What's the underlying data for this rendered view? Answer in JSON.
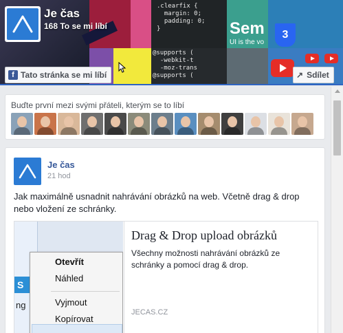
{
  "cover": {
    "page_name": "Je čas",
    "likes_text": "168 To se mi líbí",
    "code_top": ".clearfix {\n  margin: 0;\n  padding: 0;\n}",
    "code_bottom": "@supports (\n  -webkit-t\n  -moz-trans\n@supports (",
    "sem_text": "Sem",
    "sem_sub": "UI is the vo",
    "css3_label": "3"
  },
  "like_button": {
    "label": "Tato stránka se mi líbí",
    "icon": "facebook-f-icon"
  },
  "share_button": {
    "label": "Sdílet",
    "icon": "share-arrow-icon"
  },
  "friends": {
    "title": "Buďte první mezi svými přáteli, kterým se to líbí",
    "count": 13,
    "colors": [
      "#8aa2b8",
      "#c9744a",
      "#d9b89a",
      "#6f6f6f",
      "#4a4a4a",
      "#8b8b7a",
      "#6c7e8c",
      "#5a8fc0",
      "#a58c6e",
      "#3f3f3f",
      "#dcdfe4",
      "#e9e3da",
      "#c6a88f"
    ]
  },
  "post": {
    "author": "Je čas",
    "time": "21 hod",
    "text": "Jak maximálně usnadnit nahrávání obrázků na web. Včetně drag & drop nebo vložení ze schránky.",
    "link": {
      "title": "Drag & Drop upload obrázků",
      "description": "Všechny možnosti nahrávání obrázků ze schránky a pomocí drag & drop.",
      "domain": "JECAS.CZ",
      "thumb_menu": {
        "open": "Otevřít",
        "preview": "Náhled",
        "cut": "Vyjmout",
        "copy": "Kopírovat",
        "side_letters": "S",
        "side_text": "ng"
      }
    }
  },
  "scrollbar": {
    "position_fraction": 0.0
  }
}
